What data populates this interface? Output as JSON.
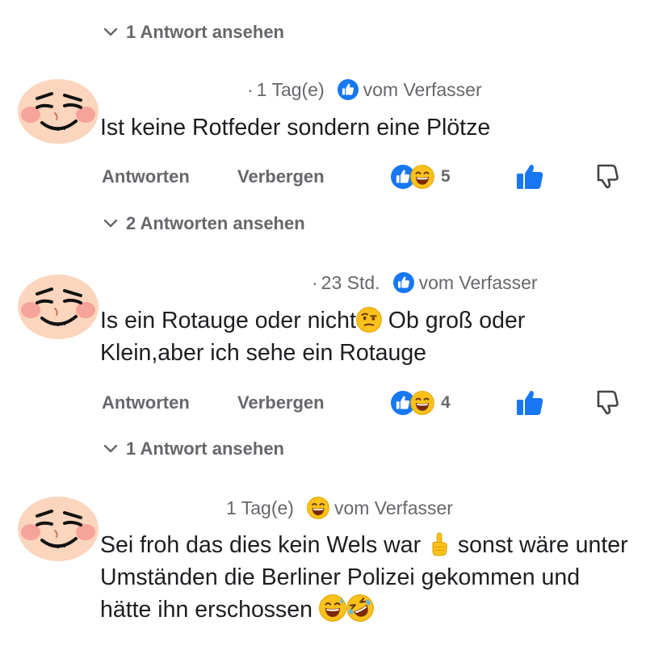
{
  "thread": {
    "top_view_replies": "1 Antwort ansehen",
    "comments": [
      {
        "time": "1 Tag(e)",
        "badge": "vom Verfasser",
        "text": "Ist keine Rotfeder sondern eine Plötze",
        "reply_label": "Antworten",
        "hide_label": "Verbergen",
        "reaction_count": "5",
        "view_replies": "2 Antworten ansehen"
      },
      {
        "time": "23 Std.",
        "badge": "vom Verfasser",
        "text_part1": "Is ein Rotauge oder nicht",
        "text_part2": " Ob groß oder Klein,aber ich sehe ein Rotauge",
        "reply_label": "Antworten",
        "hide_label": "Verbergen",
        "reaction_count": "4",
        "view_replies": "1 Antwort ansehen"
      },
      {
        "time": "1 Tag(e)",
        "badge": "vom Verfasser",
        "text_part1": "Sei froh das dies kein Wels war ",
        "text_part2": " sonst wäre unter Umständen die Berliner Polizei gekommen und hätte ihn erschossen "
      }
    ]
  },
  "icons": {
    "chevron": "chevron-down-icon",
    "like_badge": "like-badge-icon",
    "laugh_badge": "laugh-emoji-icon",
    "like_button": "thumbs-up-icon",
    "dislike_button": "thumbs-down-icon",
    "avatar": "smirk-face-avatar",
    "skeptical": "raised-eyebrow-emoji",
    "finger": "index-pointing-up-emoji",
    "sweat_smile": "grinning-sweat-emoji",
    "rofl": "rolling-laughing-emoji"
  },
  "colors": {
    "accent": "#1877f2",
    "secondary_text": "#65676b",
    "primary_text": "#1c1e21",
    "avatar_skin": "#fbd5bd",
    "emoji_yellow": "#fcc21b"
  }
}
